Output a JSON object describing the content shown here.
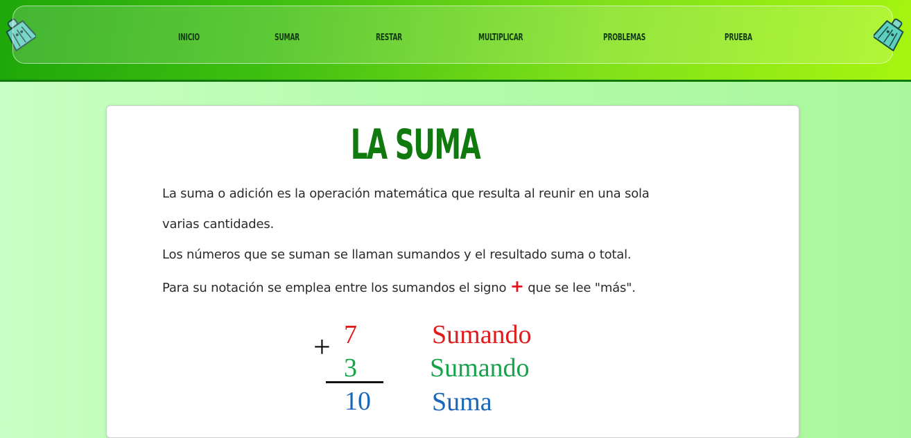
{
  "nav": {
    "items": [
      {
        "label": "INICIO"
      },
      {
        "label": "SUMAR"
      },
      {
        "label": "RESTAR"
      },
      {
        "label": "MULTIPLICAR"
      },
      {
        "label": "PROBLEMAS"
      },
      {
        "label": "PRUEBA"
      }
    ],
    "mascot_icon": "broom-character-icon",
    "colors": {
      "header_start": "#1ea70a",
      "header_end": "#a6f510",
      "nav_text": "#123b12"
    }
  },
  "content": {
    "title": "LA SUMA",
    "title_color": "#117a0f",
    "paragraph_1_line_1": "La suma o adición es la operación matemática que resulta al reunir en una sola",
    "paragraph_1_line_2": "varias cantidades.",
    "paragraph_2": "Los números que se suman se llaman sumandos y el resultado suma o total.",
    "paragraph_3_before": "Para su notación se emplea entre los sumandos el signo",
    "paragraph_3_sign": "+",
    "paragraph_3_after": "que se lee \"más\"."
  },
  "example": {
    "operator": "+",
    "addend_1": "7",
    "addend_2": "3",
    "result": "10",
    "label_1": "Sumando",
    "label_2": "Sumando",
    "label_3": "Suma",
    "colors": {
      "addend_1": "#e11b1b",
      "addend_2": "#16a34a",
      "result": "#1a66b8"
    }
  }
}
